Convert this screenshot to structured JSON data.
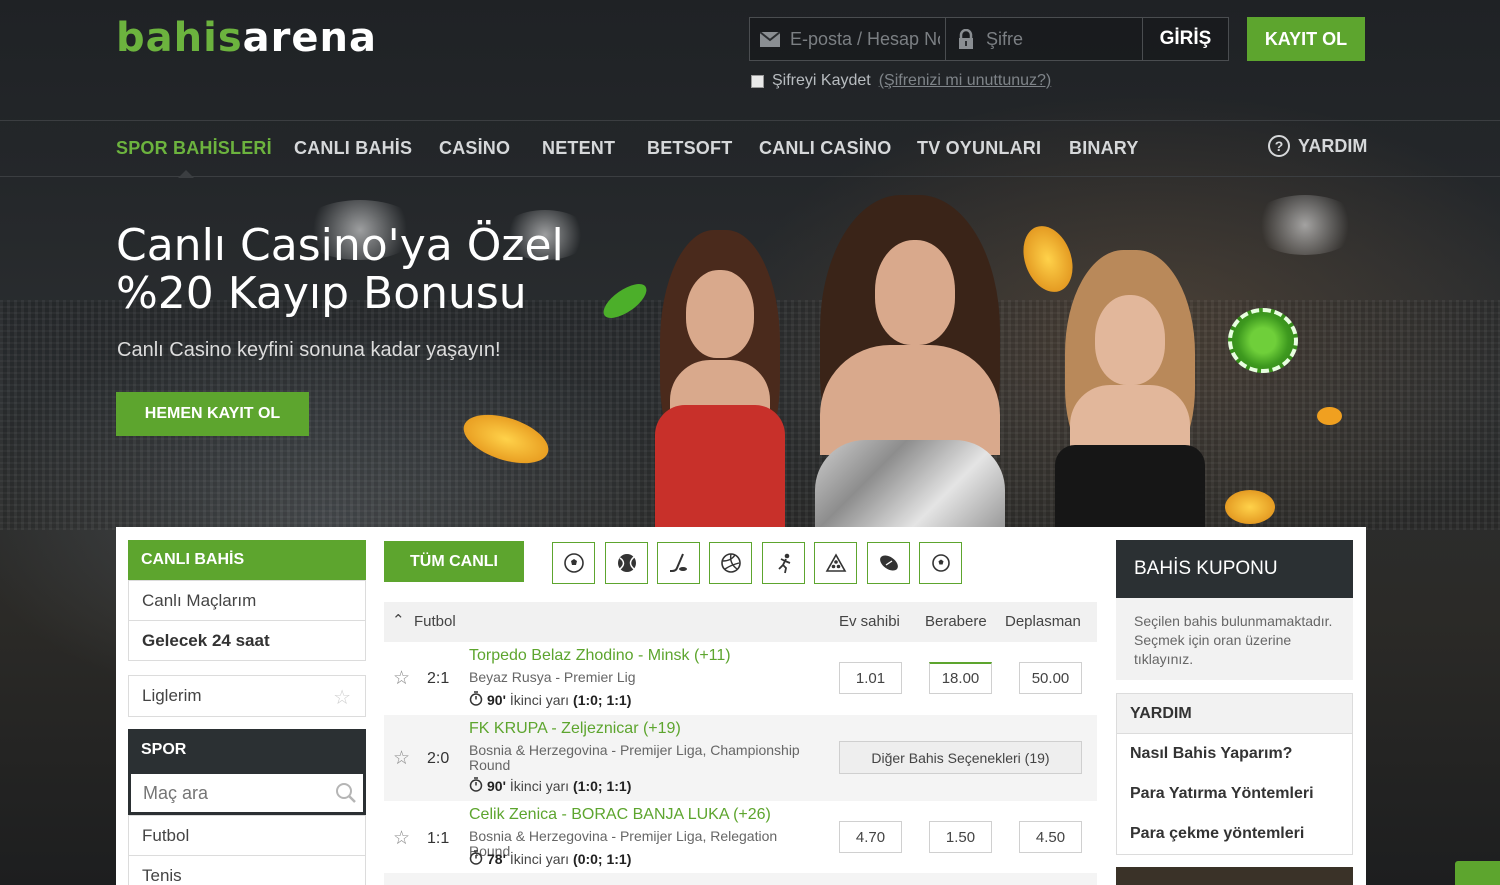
{
  "header": {
    "logo_part1": "bahis",
    "logo_part2": "arena",
    "email_placeholder": "E-posta / Hesap No",
    "password_placeholder": "Şifre",
    "login_label": "GİRİŞ",
    "register_label": "KAYIT OL",
    "remember_label": "Şifreyi Kaydet",
    "forgot_label": "(Şifrenizi mi unuttunuz?)"
  },
  "nav": {
    "items": [
      "SPOR BAHİSLERİ",
      "CANLI BAHİS",
      "CASİNO",
      "NETENT",
      "BETSOFT",
      "CANLI CASİNO",
      "TV OYUNLARI",
      "BINARY"
    ],
    "help_label": "YARDIM"
  },
  "hero": {
    "title_line1": "Canlı Casino'ya Özel",
    "title_line2": "%20 Kayıp Bonusu",
    "subtitle": "Canlı Casino keyfini sonuna kadar yaşayın!",
    "cta_label": "HEMEN KAYIT OL"
  },
  "sidebar": {
    "live_header": "CANLI BAHİS",
    "live_items": [
      "Canlı Maçlarım",
      "Gelecek 24 saat"
    ],
    "leagues_label": "Liglerim",
    "sport_header": "SPOR",
    "search_placeholder": "Maç ara",
    "sports": [
      "Futbol",
      "Tenis"
    ]
  },
  "filters": {
    "all_live_label": "TÜM CANLI",
    "sport_icons": [
      "soccer-ball-icon",
      "tennis-ball-icon",
      "hockey-icon",
      "volleyball-icon",
      "athlete-icon",
      "billiards-icon",
      "rugby-ball-icon",
      "football-icon"
    ]
  },
  "table": {
    "sport": "Futbol",
    "col_home": "Ev sahibi",
    "col_draw": "Berabere",
    "col_away": "Deplasman",
    "matches": [
      {
        "score": "2:1",
        "name": "Torpedo Belaz Zhodino - Minsk (+11)",
        "league": "Beyaz Rusya - Premier Lig",
        "minute": "90'",
        "period": "İkinci yarı",
        "detail": "(1:0; 1:1)",
        "odds": [
          "1.01",
          "18.00",
          "50.00"
        ]
      },
      {
        "score": "2:0",
        "name": "FK KRUPA - Zeljeznicar (+19)",
        "league": "Bosnia & Herzegovina - Premijer Liga, Championship Round",
        "minute": "90'",
        "period": "İkinci yarı",
        "detail": "(1:0; 1:1)",
        "more_label": "Diğer Bahis Seçenekleri (19)"
      },
      {
        "score": "1:1",
        "name": "Celik Zenica - BORAC BANJA LUKA (+26)",
        "league": "Bosnia & Herzegovina - Premijer Liga, Relegation Round",
        "minute": "78'",
        "period": "İkinci yarı",
        "detail": "(0:0; 1:1)",
        "odds": [
          "4.70",
          "1.50",
          "4.50"
        ]
      }
    ]
  },
  "coupon": {
    "header": "BAHİS KUPONU",
    "empty_text": "Seçilen bahis bulunmamaktadır. Seçmek için oran üzerine tıklayınız."
  },
  "help_box": {
    "header": "YARDIM",
    "items": [
      "Nasıl Bahis Yaparım?",
      "Para Yatırma Yöntemleri",
      "Para çekme yöntemleri"
    ]
  },
  "colors": {
    "brand_green": "#5da52e",
    "dark": "#2b3033"
  }
}
